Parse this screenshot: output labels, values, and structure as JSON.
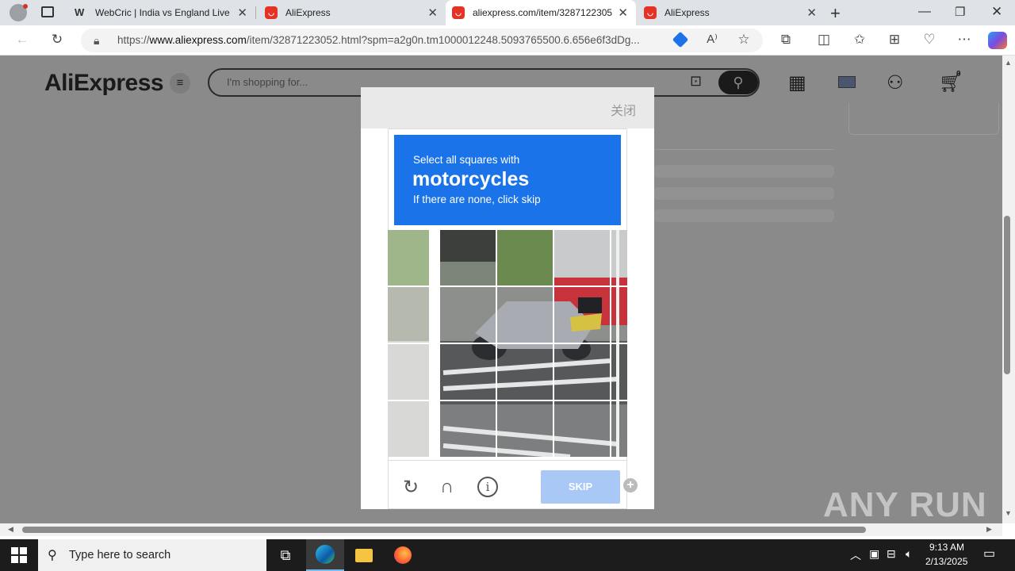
{
  "browser": {
    "tabs": [
      {
        "title": "WebCric | India vs England Live C",
        "favicon": "w-icon",
        "active": false
      },
      {
        "title": "AliExpress",
        "favicon": "aliexpress-icon",
        "active": false
      },
      {
        "title": "aliexpress.com/item/3287122305",
        "favicon": "aliexpress-icon",
        "active": true
      },
      {
        "title": "AliExpress",
        "favicon": "aliexpress-icon",
        "active": false
      }
    ],
    "url_prefix": "https://",
    "url_host": "www.aliexpress.com",
    "url_path": "/item/32871223052.html?spm=a2g0n.tm1000012248.5093765500.6.656e6f3dDg..."
  },
  "header": {
    "logo": "AliExpress",
    "search_placeholder": "I'm shopping for...",
    "cart_count": "0"
  },
  "captcha": {
    "close_label": "关闭",
    "instruction_line1": "Select all squares with",
    "target": "motorcycles",
    "instruction_line3": "If there are none, click skip",
    "skip_label": "SKIP"
  },
  "watermark": "ANY RUN",
  "taskbar": {
    "search_placeholder": "Type here to search",
    "time": "9:13 AM",
    "date": "2/13/2025"
  },
  "colors": {
    "captcha_blue": "#1a73e8",
    "skip_disabled": "#a9c8f5",
    "overlay": "#8a8a8a"
  }
}
